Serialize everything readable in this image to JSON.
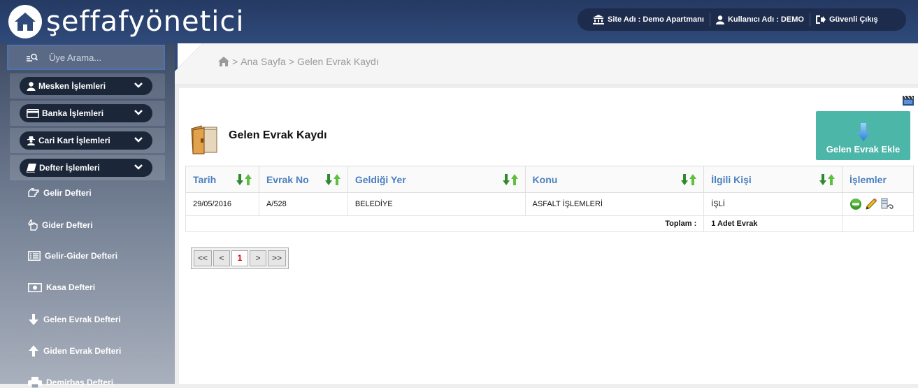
{
  "header": {
    "logo_text": "şeffafyönetici",
    "site_label": "Site Adı : Demo Apartmanı",
    "user_label": "Kullanıcı Adı : DEMO",
    "logout_label": "Güvenli Çıkış"
  },
  "sidebar": {
    "search_placeholder": "Üye Arama...",
    "menus": [
      {
        "label": "Mesken İşlemleri",
        "icon": "user-icon"
      },
      {
        "label": "Banka İşlemleri",
        "icon": "credit-card-icon"
      },
      {
        "label": "Cari Kart İşlemleri",
        "icon": "user-secret-icon"
      },
      {
        "label": "Defter İşlemleri",
        "icon": "book-icon"
      }
    ],
    "sub_items": [
      {
        "label": "Gelir Defteri",
        "icon": "hand-left-icon"
      },
      {
        "label": "Gider Defteri",
        "icon": "hand-up-icon"
      },
      {
        "label": "Gelir-Gider Defteri",
        "icon": "list-icon"
      },
      {
        "label": "Kasa Defteri",
        "icon": "money-icon"
      },
      {
        "label": "Gelen Evrak Defteri",
        "icon": "arrow-down-icon"
      },
      {
        "label": "Giden Evrak Defteri",
        "icon": "arrow-up-icon"
      },
      {
        "label": "Demirbaş Defteri",
        "icon": "print-icon"
      }
    ]
  },
  "breadcrumb": {
    "home": "Ana Sayfa",
    "current": "Gelen Evrak Kaydı",
    "separator": ">"
  },
  "page": {
    "title": "Gelen Evrak Kaydı",
    "add_button": "Gelen Evrak Ekle"
  },
  "table": {
    "columns": [
      "Tarih",
      "Evrak No",
      "Geldiği Yer",
      "Konu",
      "İlgili Kişi",
      "İşlemler"
    ],
    "rows": [
      {
        "tarih": "29/05/2016",
        "evrak_no": "A/528",
        "geldigi_yer": "BELEDİYE",
        "konu": "ASFALT İŞLEMLERİ",
        "ilgili_kisi": "İŞLİ"
      }
    ],
    "total_label": "Toplam :",
    "total_value": "1 Adet Evrak"
  },
  "pager": {
    "first": "<<",
    "prev": "<",
    "current": "1",
    "next": ">",
    "last": ">>"
  },
  "colors": {
    "topbar": "#2f4a7a",
    "accent_button": "#4cb6a9",
    "column_header": "#4a7fbf"
  }
}
